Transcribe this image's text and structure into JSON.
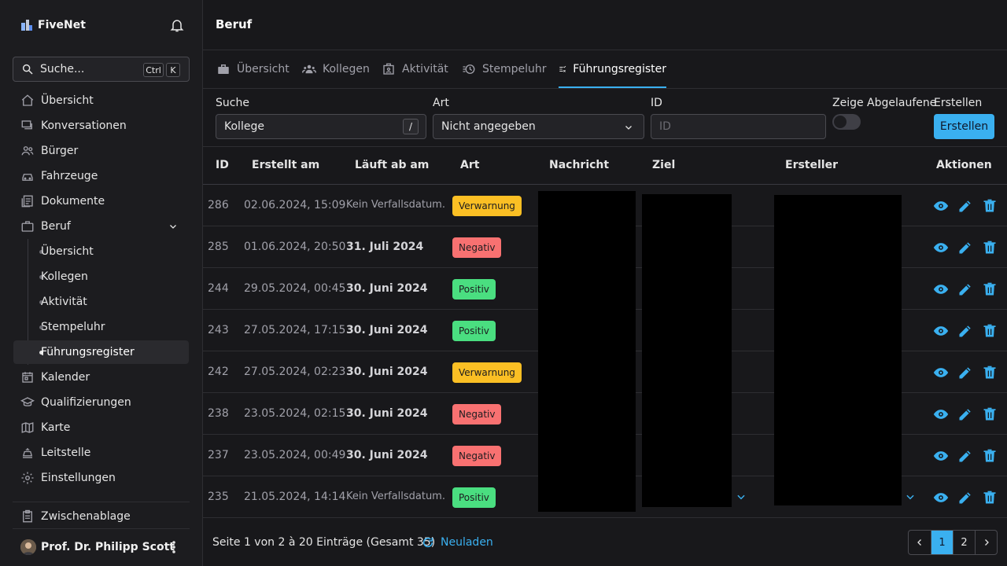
{
  "brand": {
    "name": "FiveNet"
  },
  "search": {
    "placeholder": "Suche...",
    "kbd1": "Ctrl",
    "kbd2": "K"
  },
  "nav": {
    "items": [
      {
        "label": "Übersicht",
        "icon": "home-icon"
      },
      {
        "label": "Konversationen",
        "icon": "chat-icon"
      },
      {
        "label": "Bürger",
        "icon": "users-icon"
      },
      {
        "label": "Fahrzeuge",
        "icon": "car-icon"
      },
      {
        "label": "Dokumente",
        "icon": "documents-icon"
      },
      {
        "label": "Beruf",
        "icon": "briefcase-icon"
      },
      {
        "label": "Kalender",
        "icon": "calendar-icon"
      },
      {
        "label": "Qualifizierungen",
        "icon": "school-icon"
      },
      {
        "label": "Karte",
        "icon": "map-icon"
      },
      {
        "label": "Leitstelle",
        "icon": "dispatch-icon"
      },
      {
        "label": "Einstellungen",
        "icon": "gear-icon"
      }
    ],
    "sub": [
      "Übersicht",
      "Kollegen",
      "Aktivität",
      "Stempeluhr",
      "Führungsregister"
    ],
    "clipboard": "Zwischenablage"
  },
  "user": {
    "name": "Prof. Dr. Philipp Scott"
  },
  "page": {
    "title": "Beruf"
  },
  "tabs": [
    "Übersicht",
    "Kollegen",
    "Aktivität",
    "Stempeluhr",
    "Führungsregister"
  ],
  "filters": {
    "search_label": "Suche",
    "search_value": "Kollege",
    "search_kbd": "/",
    "type_label": "Art",
    "type_value": "Nicht angegeben",
    "id_label": "ID",
    "id_placeholder": "ID",
    "expired_label": "Zeige Abgelaufene",
    "create_label": "Erstellen",
    "create_button": "Erstellen"
  },
  "table": {
    "headers": [
      "ID",
      "Erstellt am",
      "Läuft ab am",
      "Art",
      "Nachricht",
      "Ziel",
      "Ersteller",
      "Aktionen"
    ],
    "rows": [
      {
        "id": "286",
        "created": "02.06.2024, 15:09",
        "expires": "Kein Verfallsdatum.",
        "type": "Verwarnung"
      },
      {
        "id": "285",
        "created": "01.06.2024, 20:50",
        "expires": "31. Juli 2024",
        "type": "Negativ"
      },
      {
        "id": "244",
        "created": "29.05.2024, 00:45",
        "expires": "30. Juni 2024",
        "type": "Positiv"
      },
      {
        "id": "243",
        "created": "27.05.2024, 17:15",
        "expires": "30. Juni 2024",
        "type": "Positiv"
      },
      {
        "id": "242",
        "created": "27.05.2024, 02:23",
        "expires": "30. Juni 2024",
        "type": "Verwarnung"
      },
      {
        "id": "238",
        "created": "23.05.2024, 02:15",
        "expires": "30. Juni 2024",
        "type": "Negativ"
      },
      {
        "id": "237",
        "created": "23.05.2024, 00:49",
        "expires": "30. Juni 2024",
        "type": "Negativ"
      },
      {
        "id": "235",
        "created": "21.05.2024, 14:14",
        "expires": "Kein Verfallsdatum.",
        "type": "Positiv"
      }
    ]
  },
  "badge_colors": {
    "Verwarnung": "#fbbf24",
    "Negativ": "#f87171",
    "Positiv": "#4ade80"
  },
  "accent": "#3ab0f0",
  "footer": {
    "summary": "Seite 1 von 2 à 20 Einträge (Gesamt 35)",
    "reload": "Neuladen",
    "pages": [
      "1",
      "2"
    ],
    "current_page": "1"
  }
}
